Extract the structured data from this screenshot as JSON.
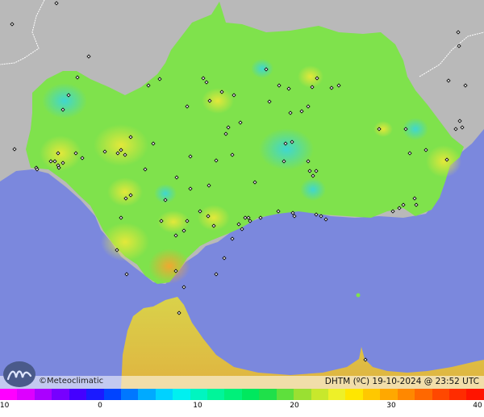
{
  "brand": {
    "name": "Meteoclimatic",
    "copyright_symbol": "©",
    "logo_icon": "meteoclimatic-logo-icon"
  },
  "status": {
    "text": "DHTM (ºC)  19-10-2024 @ 23:52 UTC"
  },
  "legend": {
    "ticks": [
      "-10",
      "0",
      "10",
      "20",
      "30",
      "40"
    ],
    "colors": [
      "#ff00ff",
      "#dd00ff",
      "#aa00ff",
      "#7700ff",
      "#4400ff",
      "#1a1aff",
      "#0044ff",
      "#0077ff",
      "#00aaff",
      "#00d2ff",
      "#00f0f0",
      "#00f5c0",
      "#00f59a",
      "#00f07a",
      "#00e85e",
      "#1fe04a",
      "#5ee03c",
      "#9ae032",
      "#c8e82c",
      "#eef028",
      "#ffe600",
      "#ffc800",
      "#ffa800",
      "#ff8800",
      "#ff6800",
      "#ff4800",
      "#ff2c00",
      "#ff1400"
    ]
  },
  "colors": {
    "sea": "#7b88dd",
    "land_gray": "#b9b9b9",
    "region_green": "#7fe24c"
  }
}
